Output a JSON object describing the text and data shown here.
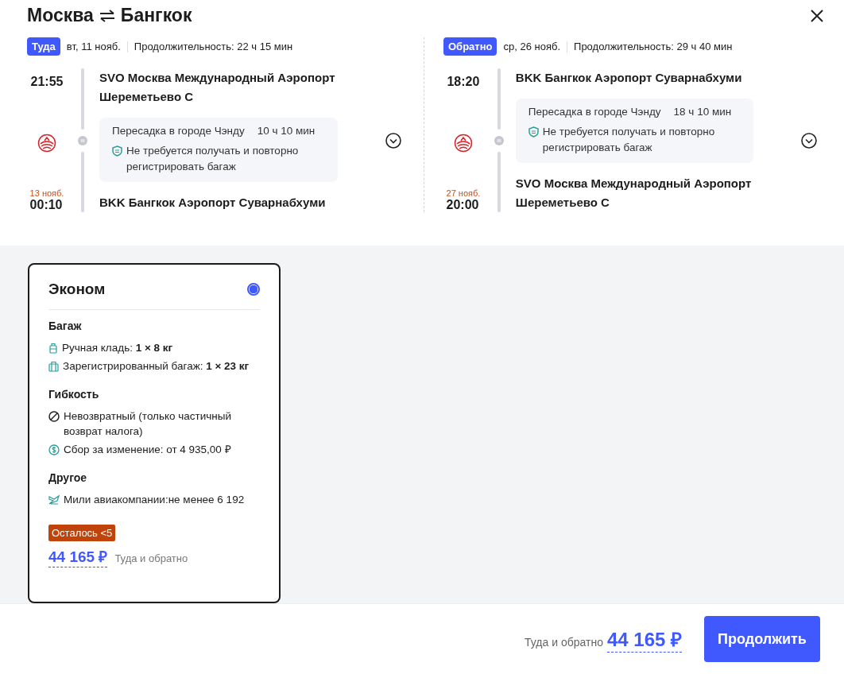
{
  "header": {
    "from": "Москва",
    "to": "Бангкок"
  },
  "legs": [
    {
      "tag": "Туда",
      "date": "вт, 11 нояб.",
      "duration": "Продолжительность: 22 ч 15 мин",
      "dep_time": "21:55",
      "dep_airport": "SVO Москва Международный Аэропорт Шереметьево C",
      "transfer": "Пересадка в городе Чэнду",
      "transfer_time": "10 ч 10 мин",
      "baggage_note": "Не требуется получать и повторно регистрировать багаж",
      "arr_date": "13 нояб.",
      "arr_time": "00:10",
      "arr_airport": "BKK Бангкок Аэропорт Суварнабхуми"
    },
    {
      "tag": "Обратно",
      "date": "ср, 26 нояб.",
      "duration": "Продолжительность: 29 ч 40 мин",
      "dep_time": "18:20",
      "dep_airport": "BKK Бангкок Аэропорт Суварнабхуми",
      "transfer": "Пересадка в городе Чэнду",
      "transfer_time": "18 ч 10 мин",
      "baggage_note": "Не требуется получать и повторно регистрировать багаж",
      "arr_date": "27 нояб.",
      "arr_time": "20:00",
      "arr_airport": "SVO Москва Международный Аэропорт Шереметьево C"
    }
  ],
  "fares": [
    {
      "name": "Эконом",
      "selected": true,
      "sections": [
        {
          "title": "Багаж",
          "items": [
            {
              "kind": "carry_on",
              "text": "Ручная кладь: **1 × 8 кг**"
            },
            {
              "kind": "checked_bag",
              "text": "Зарегистрированный багаж: **1 × 23 кг**"
            }
          ]
        },
        {
          "title": "Гибкость",
          "items": [
            {
              "kind": "no_refund",
              "text": "Невозвратный (только частичный возврат налога)"
            },
            {
              "kind": "fee",
              "text": "Сбор за изменение: от 4 935,00 ₽"
            }
          ]
        },
        {
          "title": "Другое",
          "items": [
            {
              "kind": "miles",
              "text": "Мили авиакомпании:не менее 6 192"
            }
          ]
        }
      ],
      "badge": "Осталось <5",
      "price": "44 165 ₽",
      "price_note": "Туда и обратно"
    }
  ],
  "footer": {
    "label": "Туда и обратно",
    "price": "44 165 ₽",
    "button": "Продолжить"
  }
}
